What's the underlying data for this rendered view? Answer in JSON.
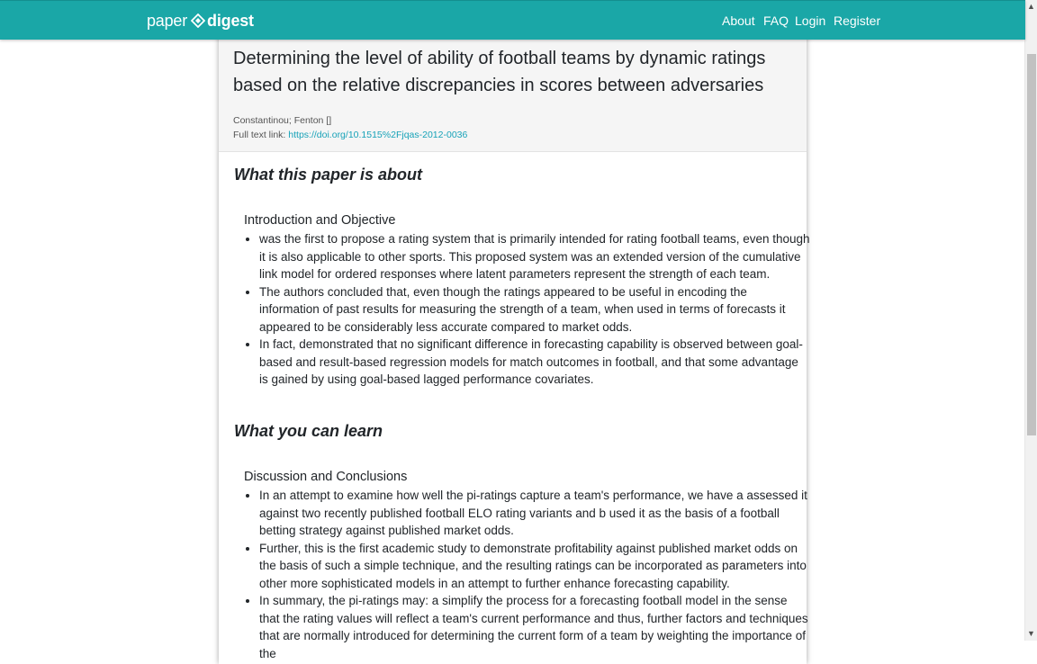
{
  "nav": {
    "brand_part1": "paper",
    "brand_part2": "digest",
    "links": [
      "About",
      "FAQ",
      "Login",
      "Register"
    ]
  },
  "paper": {
    "title": "Determining the level of ability of football teams by dynamic ratings based on the relative discrepancies in scores between adversaries",
    "authors": "Constantinou; Fenton []",
    "full_text_label": "Full text link:",
    "full_text_url": "https://doi.org/10.1515%2Fjqas-2012-0036"
  },
  "sections": [
    {
      "heading": "What this paper is about",
      "subheading": "Introduction and Objective",
      "bullets": [
        "was the first to propose a rating system that is primarily intended for rating football teams, even though it is also applicable to other sports. This proposed system was an extended version of the cumulative link model for ordered responses where latent parameters represent the strength of each team.",
        "The authors concluded that, even though the ratings appeared to be useful in encoding the information of past results for measuring the strength of a team, when used in terms of forecasts it appeared to be considerably less accurate compared to market odds.",
        "In fact, demonstrated that no significant difference in forecasting capability is observed between goal-based and result-based regression models for match outcomes in football, and that some advantage is gained by using goal-based lagged performance covariates."
      ]
    },
    {
      "heading": "What you can learn",
      "subheading": "Discussion and Conclusions",
      "bullets": [
        "In an attempt to examine how well the pi-ratings capture a team's performance, we have a assessed it against two recently published football ELO rating variants and b used it as the basis of a football betting strategy against published market odds.",
        "Further, this is the first academic study to demonstrate profitability against published market odds on the basis of such a simple technique, and the resulting ratings can be incorporated as parameters into other more sophisticated models in an attempt to further enhance forecasting capability.",
        "In summary, the pi-ratings may: a simplify the process for a forecasting football model in the sense that the rating values will reflect a team's current performance and thus, further factors and techniques that are normally introduced for determining the current form of a team by weighting the importance of the"
      ]
    }
  ],
  "colors": {
    "brand": "#1aa7a7",
    "link": "#17a2b8"
  }
}
